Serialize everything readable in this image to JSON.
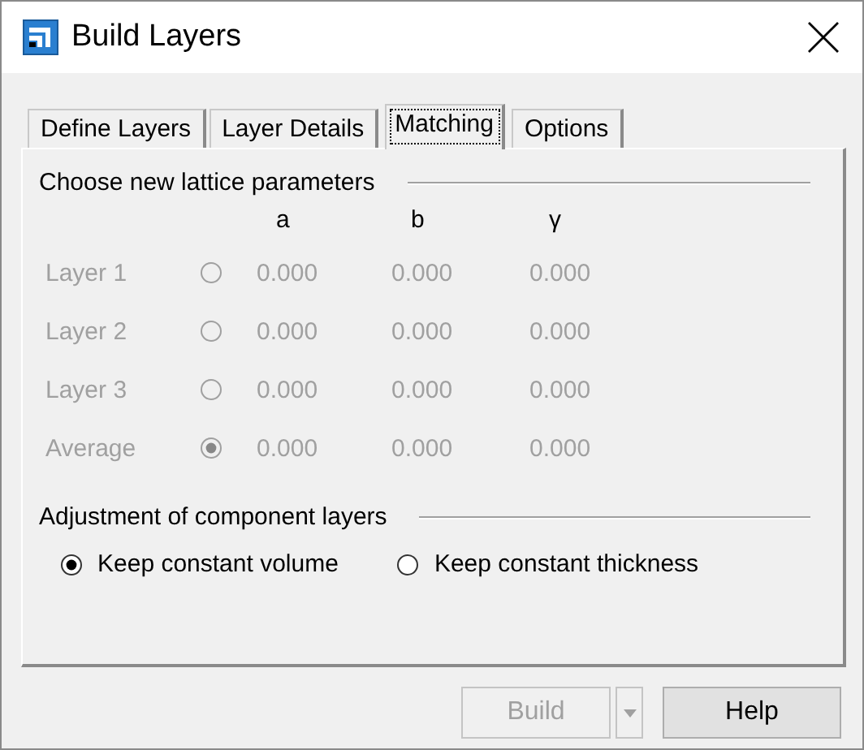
{
  "window": {
    "title": "Build Layers"
  },
  "tabs": [
    {
      "label": "Define Layers",
      "selected": false
    },
    {
      "label": "Layer Details",
      "selected": false
    },
    {
      "label": "Matching",
      "selected": true
    },
    {
      "label": "Options",
      "selected": false
    }
  ],
  "lattice": {
    "title": "Choose new lattice parameters",
    "columns": [
      "a",
      "b",
      "γ"
    ],
    "rows": [
      {
        "label": "Layer 1",
        "selected": false,
        "disabled": true,
        "values": [
          "0.000",
          "0.000",
          "0.000"
        ]
      },
      {
        "label": "Layer 2",
        "selected": false,
        "disabled": true,
        "values": [
          "0.000",
          "0.000",
          "0.000"
        ]
      },
      {
        "label": "Layer 3",
        "selected": false,
        "disabled": true,
        "values": [
          "0.000",
          "0.000",
          "0.000"
        ]
      },
      {
        "label": "Average",
        "selected": true,
        "disabled": true,
        "values": [
          "0.000",
          "0.000",
          "0.000"
        ]
      }
    ]
  },
  "adjustment": {
    "title": "Adjustment of component layers",
    "options": [
      {
        "label": "Keep constant volume",
        "selected": true
      },
      {
        "label": "Keep constant thickness",
        "selected": false
      }
    ]
  },
  "buttons": [
    {
      "label": "Build",
      "disabled": true,
      "dropdown": true
    },
    {
      "label": "Help",
      "disabled": false,
      "dropdown": false
    }
  ]
}
